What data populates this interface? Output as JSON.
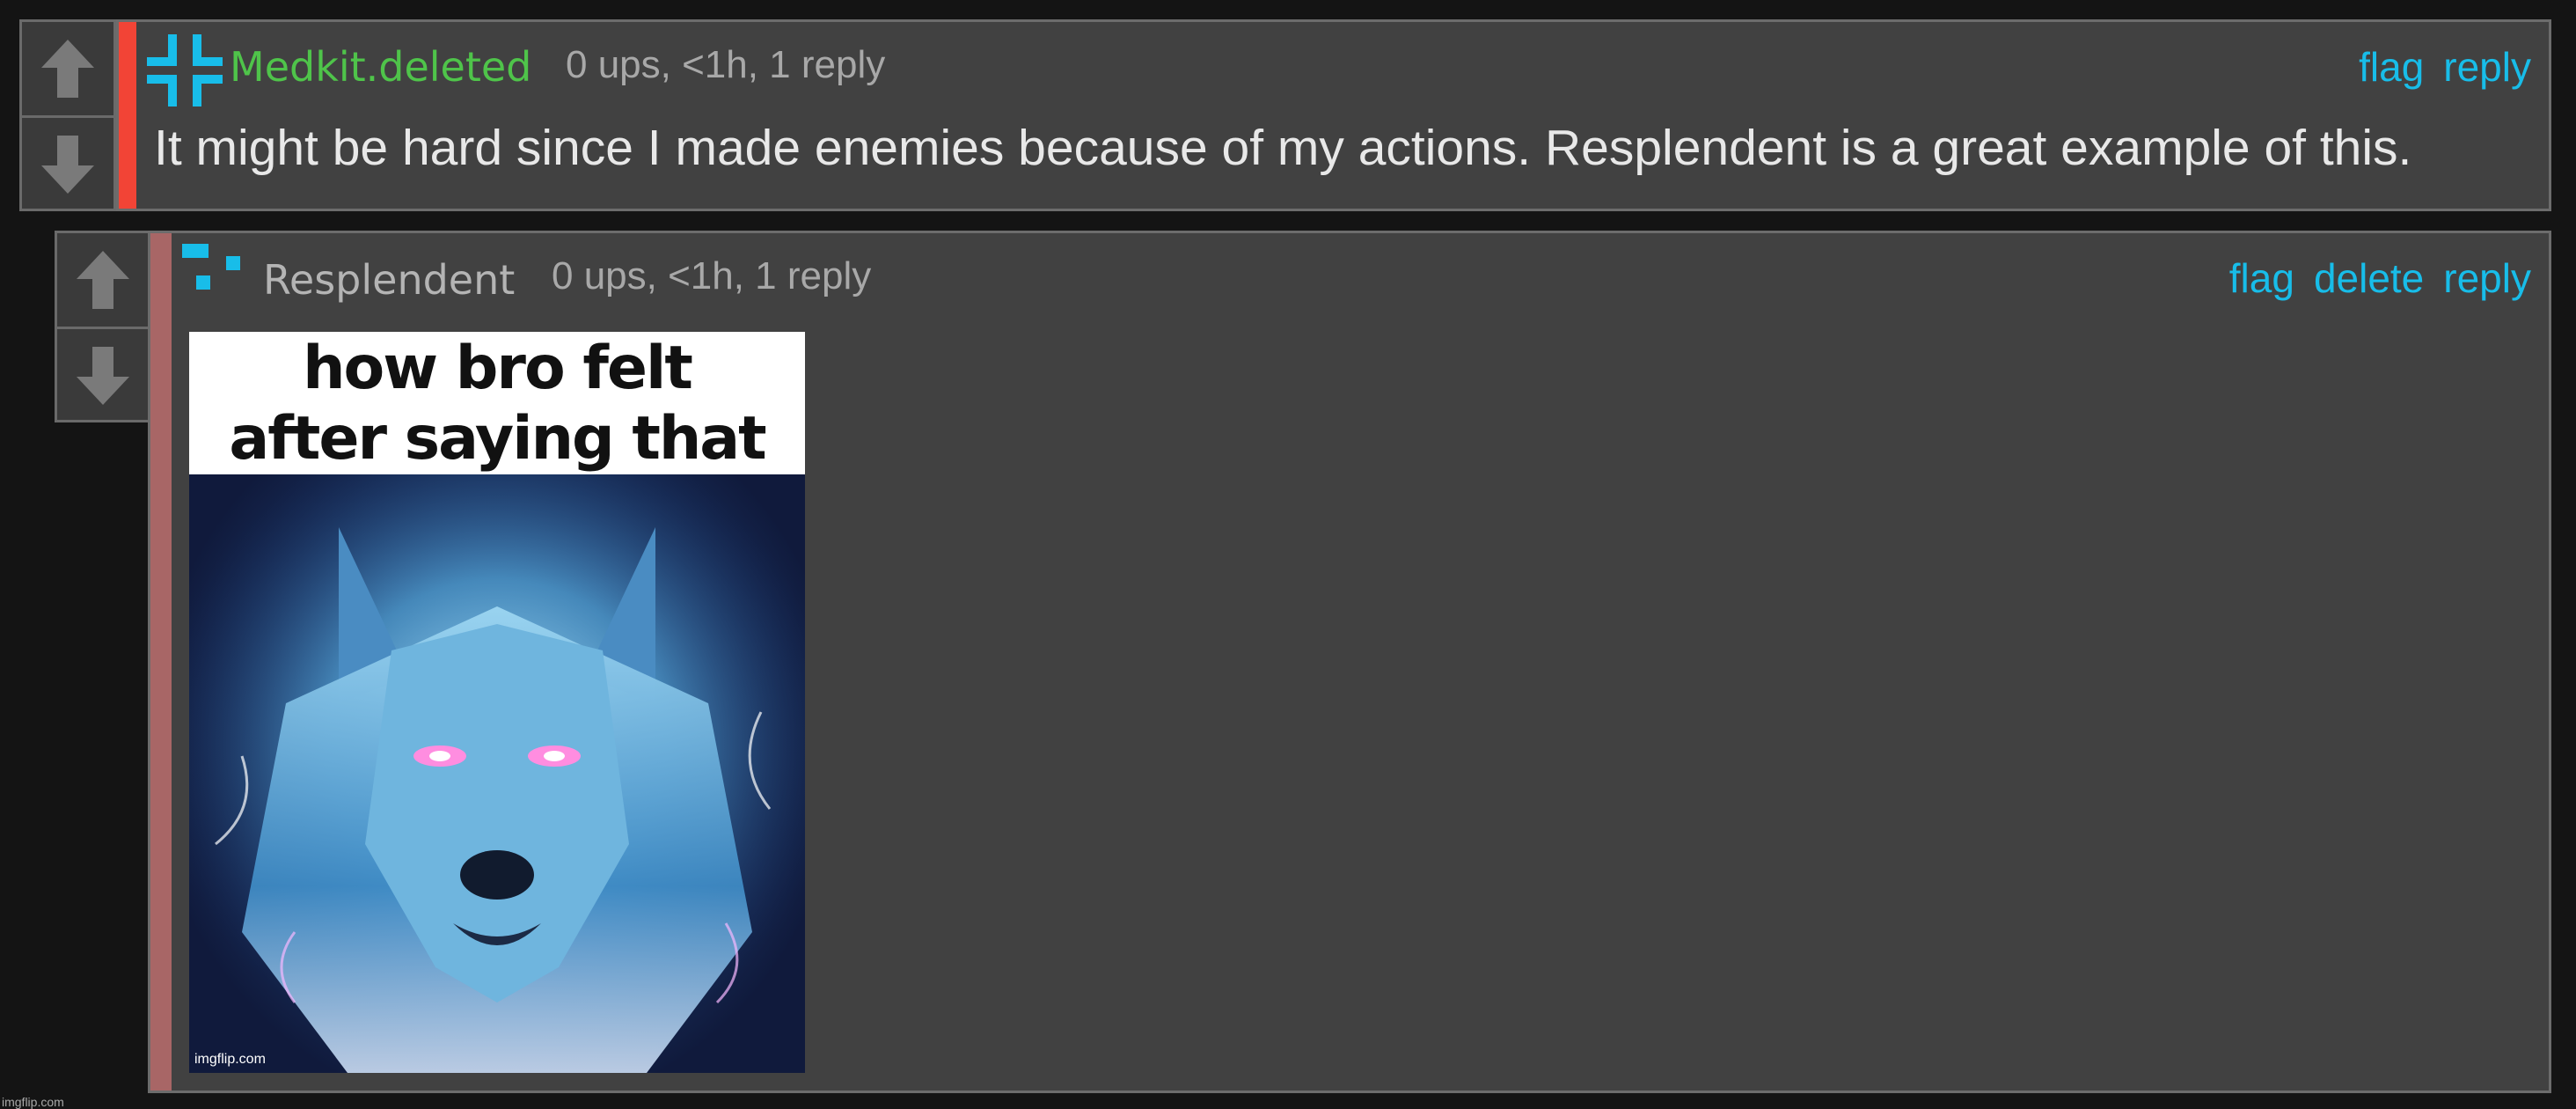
{
  "colors": {
    "accent_link": "#18bde9",
    "username_green": "#4fc44a",
    "username_gray": "#b4b4b4",
    "bar_red": "#f24436",
    "bar_dim": "#a86666"
  },
  "comments": [
    {
      "username": "Medkit.deleted",
      "meta": "0 ups, <1h, 1 reply",
      "avatar_icon": "medkit-cross-icon",
      "actions": [
        "flag",
        "reply"
      ],
      "body": "It might be hard since I made enemies because of my actions. Resplendent is a great example of this."
    },
    {
      "username": "Resplendent",
      "meta": "0 ups, <1h, 1 reply",
      "avatar_icon": "pixel-squares-icon",
      "actions": [
        "flag",
        "delete",
        "reply"
      ],
      "image": {
        "caption": "how bro felt\nafter saying that",
        "watermark": "imgflip.com",
        "subject": "glowing-wolf-illustration"
      }
    }
  ],
  "footer": {
    "corner_mark": "imgflip.com"
  }
}
